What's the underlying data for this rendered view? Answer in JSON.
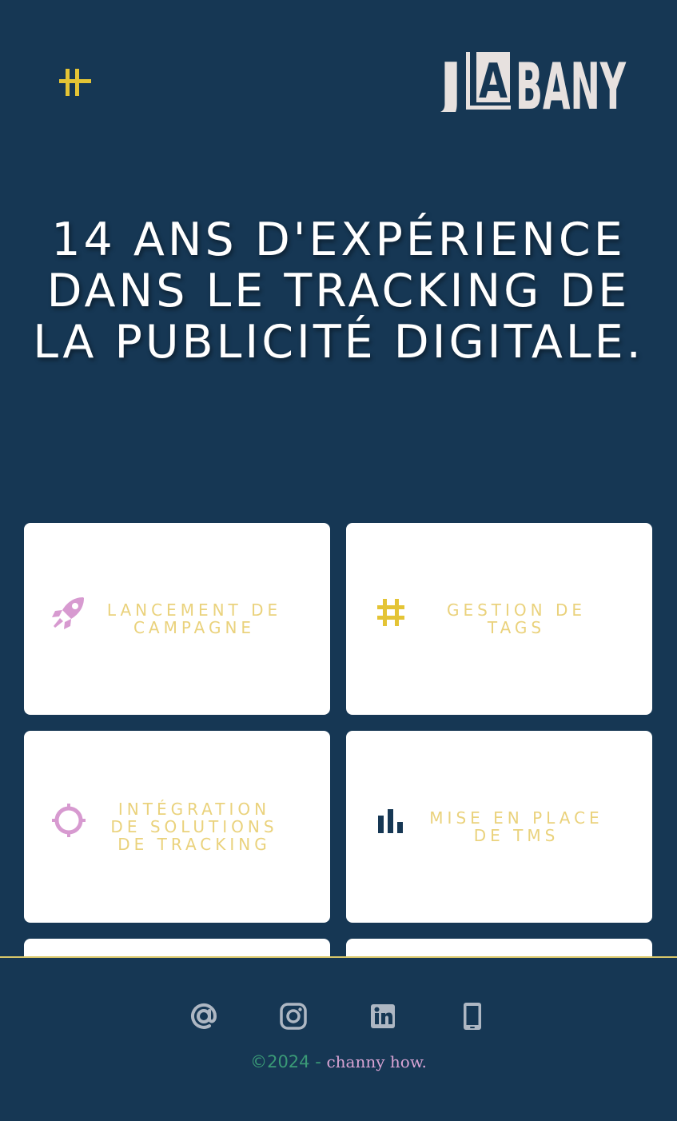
{
  "header": {
    "menu_icon": "hash-menu-icon",
    "logo_text": "JLABANY",
    "logo_letters": [
      "J",
      "L",
      "A",
      "BANY"
    ]
  },
  "hero": {
    "title": "14 ANS D'EXPÉRIENCE DANS LE TRACKING DE LA PUBLICITÉ DIGITALE."
  },
  "services": [
    {
      "label": "LANCEMENT DE CAMPAGNE",
      "icon": "rocket-icon",
      "color": "#d79ad0"
    },
    {
      "label": "GESTION DE TAGS",
      "icon": "hashtag-icon",
      "color": "#e4c435"
    },
    {
      "label": "INTÉGRATION DE SOLUTIONS DE TRACKING",
      "icon": "crosshair-icon",
      "color": "#d79ad0"
    },
    {
      "label": "MISE EN PLACE DE TMS",
      "icon": "bar-chart-icon",
      "color": "#163754"
    }
  ],
  "footer": {
    "socials": [
      "at-sign-icon",
      "instagram-icon",
      "linkedin-icon",
      "mobile-phone-icon"
    ],
    "copyright_year": "©2024 -",
    "copyright_brand": "channy how."
  },
  "colors": {
    "background": "#163754",
    "accent_yellow": "#e4c435",
    "label_yellow": "#ead27c",
    "accent_pink": "#d79ad0",
    "logo": "#e7e1df",
    "footer_green": "#3a9a76"
  }
}
